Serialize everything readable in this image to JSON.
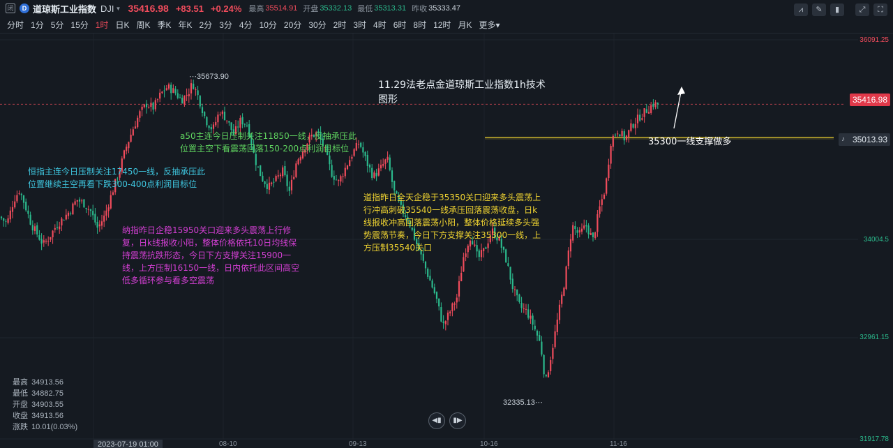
{
  "header": {
    "close_glyph": "闭",
    "logo_glyph": "D",
    "name": "道琼斯工业指数",
    "symbol": "DJI",
    "price": "35416.98",
    "change": "+83.51",
    "change_pct": "+0.24%",
    "high_label": "最高",
    "high": "35514.91",
    "open_label": "开盘",
    "open": "35332.13",
    "low_label": "最低",
    "low": "35313.31",
    "prev_label": "昨收",
    "prev": "35333.47"
  },
  "periods": [
    "分时",
    "1分",
    "5分",
    "15分",
    "1时",
    "日K",
    "周K",
    "季K",
    "年K",
    "2分",
    "3分",
    "4分",
    "10分",
    "20分",
    "30分",
    "2时",
    "3时",
    "4时",
    "6时",
    "8时",
    "12时",
    "月K",
    "更多▾"
  ],
  "active_period": "1时",
  "tools": [
    "indicator-icon",
    "pen-icon",
    "trash-icon",
    "expand-icon",
    "fullscreen-icon"
  ],
  "y_axis": {
    "labels": [
      "36091.25",
      "34004.5",
      "32961.15",
      "31917.78"
    ],
    "current_price": "35416.98",
    "alert_price": "35013.93"
  },
  "x_axis": {
    "hover_date": "2023-07-19 01:00",
    "labels": [
      "08-10",
      "09-13",
      "10-16",
      "11-16"
    ]
  },
  "extremes": {
    "high": "35673.90",
    "low": "32335.13"
  },
  "annotations": {
    "title": "11.29法老点金道琼斯工业指数1h技术\n图形",
    "support": "35300一线支撑做多",
    "hsi": "恒指主连今日压制关注17450一线，反抽承压此\n位置继续主空再看下跌300-400点利润目标位",
    "a50": "a50主连今日压制关注11850一线，反抽承压此\n位置主空下看震荡回落150-200点利润目标位",
    "nasdaq": "纳指昨日企稳15950关口迎来多头震荡上行修\n复，日k线报收小阳，整体价格依托10日均线保\n持震荡抗跌形态，今日下方支撑关注15900一\n线，上方压制16150一线，日内依托此区间高空\n低多循环参与看多空震荡",
    "dow": "道指昨日全天企稳于35350关口迎来多头震荡上\n行冲高刺破35540一线承压回落震荡收盘，日k\n线报收冲高回落震荡小阳，整体价格延续多头强\n势震荡节奏，今日下方支撑关注35300一线，上\n方压制35540关口"
  },
  "ohlc_panel": {
    "high_label": "最高",
    "high": "34913.56",
    "low_label": "最低",
    "low": "34882.75",
    "open_label": "开盘",
    "open": "34903.55",
    "close_label": "收盘",
    "close": "34913.56",
    "change_label": "涨跌",
    "change": "10.01(0.03%)"
  },
  "colors": {
    "up": "#f14c5c",
    "down": "#2bb98c",
    "background": "#151a21",
    "support_line": "#f0d431",
    "hsi_text": "#3fc7e0",
    "a50_text": "#5fd35f",
    "nasdaq_text": "#d33fd3",
    "dow_text": "#f0d431"
  },
  "chart_data": {
    "type": "candlestick",
    "ylim": [
      31917.78,
      36091.25
    ],
    "series_shape_close": [
      [
        0,
        34240
      ],
      [
        10,
        34170
      ],
      [
        20,
        34420
      ],
      [
        28,
        34520
      ],
      [
        35,
        34380
      ],
      [
        45,
        34160
      ],
      [
        55,
        34040
      ],
      [
        62,
        33950
      ],
      [
        70,
        34020
      ],
      [
        80,
        34140
      ],
      [
        90,
        34220
      ],
      [
        100,
        34300
      ],
      [
        110,
        34420
      ],
      [
        120,
        34380
      ],
      [
        130,
        34300
      ],
      [
        140,
        34120
      ],
      [
        150,
        34250
      ],
      [
        160,
        34480
      ],
      [
        170,
        34700
      ],
      [
        180,
        34950
      ],
      [
        190,
        35150
      ],
      [
        200,
        35320
      ],
      [
        210,
        35420
      ],
      [
        220,
        35380
      ],
      [
        230,
        35520
      ],
      [
        240,
        35600
      ],
      [
        250,
        35550
      ],
      [
        260,
        35460
      ],
      [
        270,
        35540
      ],
      [
        276,
        35640
      ],
      [
        285,
        35480
      ],
      [
        295,
        35250
      ],
      [
        305,
        35150
      ],
      [
        315,
        35350
      ],
      [
        325,
        35260
      ],
      [
        335,
        35100
      ],
      [
        345,
        35250
      ],
      [
        355,
        35200
      ],
      [
        365,
        34850
      ],
      [
        375,
        34650
      ],
      [
        385,
        34550
      ],
      [
        395,
        34620
      ],
      [
        405,
        34720
      ],
      [
        415,
        34500
      ],
      [
        425,
        34820
      ],
      [
        435,
        34950
      ],
      [
        445,
        35080
      ],
      [
        455,
        35120
      ],
      [
        465,
        34950
      ],
      [
        475,
        34700
      ],
      [
        485,
        34600
      ],
      [
        495,
        34750
      ],
      [
        505,
        34900
      ],
      [
        515,
        35020
      ],
      [
        525,
        34820
      ],
      [
        535,
        34660
      ],
      [
        545,
        34740
      ],
      [
        555,
        34850
      ],
      [
        565,
        34500
      ],
      [
        575,
        34320
      ],
      [
        585,
        34220
      ],
      [
        595,
        34000
      ],
      [
        605,
        33800
      ],
      [
        615,
        33600
      ],
      [
        625,
        33400
      ],
      [
        635,
        33100
      ],
      [
        645,
        33250
      ],
      [
        655,
        33400
      ],
      [
        665,
        33850
      ],
      [
        675,
        34050
      ],
      [
        685,
        33800
      ],
      [
        695,
        33900
      ],
      [
        705,
        34100
      ],
      [
        715,
        34000
      ],
      [
        725,
        33800
      ],
      [
        735,
        33500
      ],
      [
        745,
        33300
      ],
      [
        755,
        33250
      ],
      [
        765,
        33100
      ],
      [
        775,
        32900
      ],
      [
        782,
        32500
      ],
      [
        790,
        32800
      ],
      [
        800,
        33200
      ],
      [
        810,
        33600
      ],
      [
        820,
        34150
      ],
      [
        830,
        34050
      ],
      [
        840,
        34150
      ],
      [
        850,
        34000
      ],
      [
        860,
        34350
      ],
      [
        868,
        34550
      ],
      [
        876,
        35050
      ],
      [
        886,
        35150
      ],
      [
        896,
        35050
      ],
      [
        906,
        35200
      ],
      [
        916,
        35280
      ],
      [
        926,
        35350
      ],
      [
        936,
        35420
      ],
      [
        945,
        35417
      ]
    ]
  }
}
